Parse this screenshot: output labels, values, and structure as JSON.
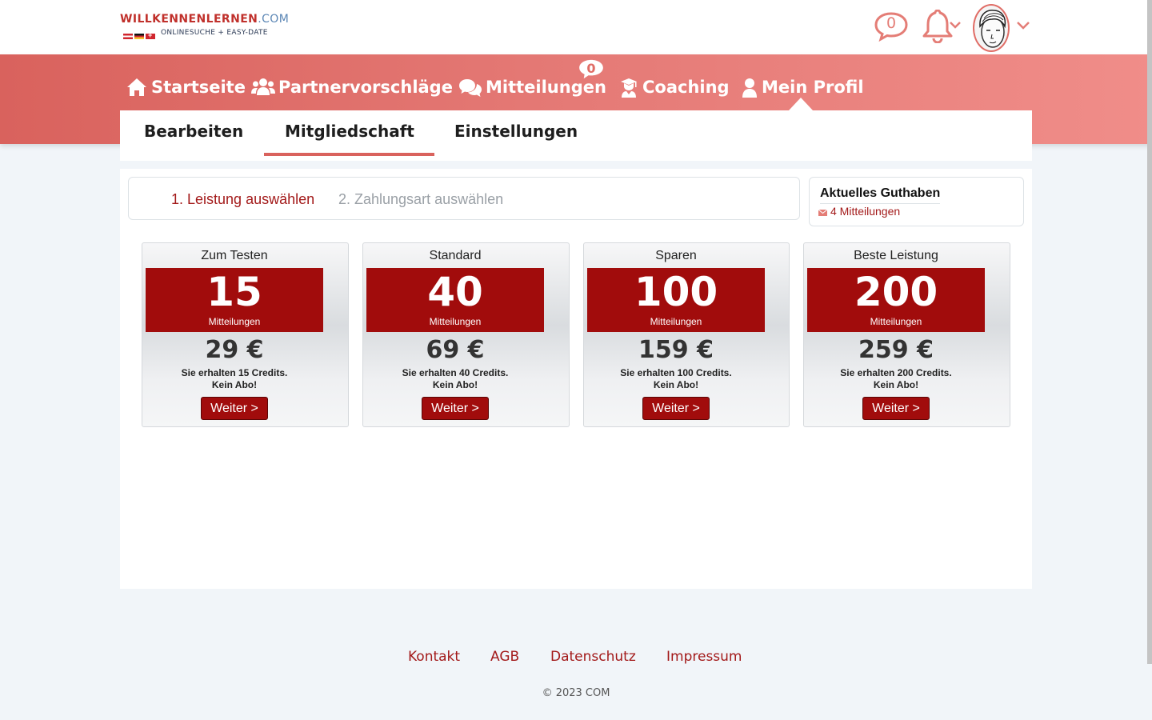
{
  "logo": {
    "name_main": "WILLKENNENLERNEN",
    "name_tld": ".COM",
    "tagline": "ONLINESUCHE + EASY-DATE"
  },
  "header": {
    "messages_count": "0",
    "icons": [
      "chat-bubble-icon",
      "bell-icon",
      "avatar",
      "chevron-down-icon"
    ]
  },
  "nav": {
    "items": [
      {
        "label": "Startseite",
        "icon": "home-icon"
      },
      {
        "label": "Partnervorschläge",
        "icon": "users-icon"
      },
      {
        "label": "Mitteilungen",
        "icon": "comments-icon",
        "badge": "0"
      },
      {
        "label": "Coaching",
        "icon": "teacher-icon"
      },
      {
        "label": "Mein Profil",
        "icon": "user-icon",
        "active": true
      }
    ]
  },
  "subtabs": [
    {
      "label": "Bearbeiten"
    },
    {
      "label": "Mitgliedschaft",
      "active": true
    },
    {
      "label": "Einstellungen"
    }
  ],
  "steps": {
    "step1": "1. Leistung auswählen",
    "step2": "2. Zahlungsart auswählen"
  },
  "credit": {
    "title": "Aktuelles Guthaben",
    "line": "4 Mitteilungen"
  },
  "packages": [
    {
      "name": "Zum Testen",
      "amount": "15",
      "unit": "Mitteilungen",
      "price": "29 €",
      "info1": "Sie erhalten 15 Credits.",
      "info2": "Kein Abo!",
      "button": "Weiter >"
    },
    {
      "name": "Standard",
      "amount": "40",
      "unit": "Mitteilungen",
      "price": "69 €",
      "info1": "Sie erhalten 40 Credits.",
      "info2": "Kein Abo!",
      "button": "Weiter >"
    },
    {
      "name": "Sparen",
      "amount": "100",
      "unit": "Mitteilungen",
      "price": "159 €",
      "info1": "Sie erhalten 100 Credits.",
      "info2": "Kein Abo!",
      "button": "Weiter >"
    },
    {
      "name": "Beste Leistung",
      "amount": "200",
      "unit": "Mitteilungen",
      "price": "259 €",
      "info1": "Sie erhalten 200 Credits.",
      "info2": "Kein Abo!",
      "button": "Weiter >"
    }
  ],
  "footer": {
    "links": [
      "Kontakt",
      "AGB",
      "Datenschutz",
      "Impressum"
    ],
    "copyright": "© 2023 COM"
  },
  "colors": {
    "brand_red": "#a10c0c",
    "nav_red": "#e06d66",
    "background": "#f1f5f9"
  }
}
